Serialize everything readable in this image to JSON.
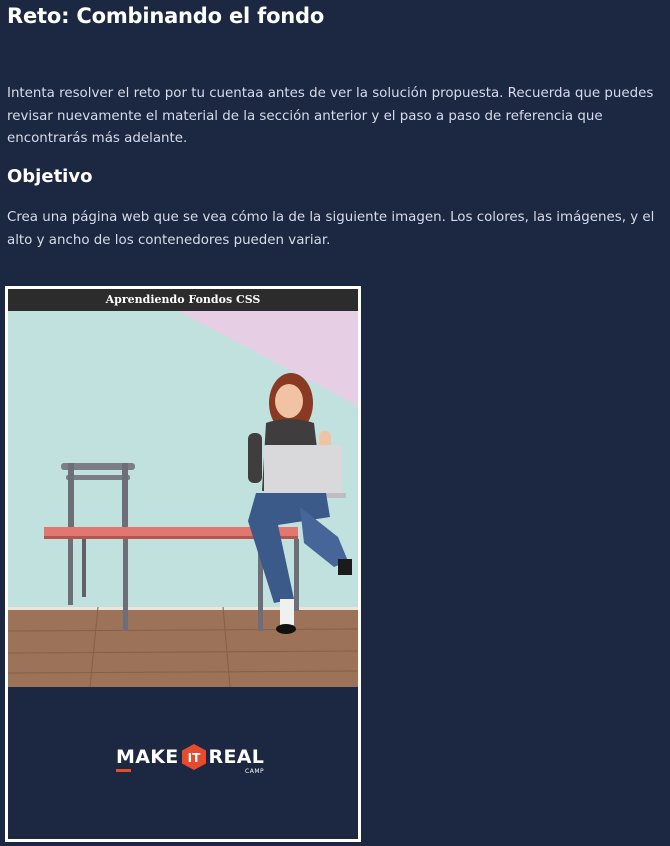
{
  "page": {
    "title": "Reto: Combinando el fondo",
    "intro": "Intenta resolver el reto por tu cuentaa antes de ver la solución propuesta. Recuerda que puedes revisar nuevamente el material de la sección anterior y el paso a paso de referencia que encontrarás más adelante.",
    "objective_heading": "Objetivo",
    "objective_text": "Crea una página web que se vea cómo la de la siguiente imagen. Los colores, las imágenes, y el alto y ancho de los contenedores pueden variar."
  },
  "preview": {
    "header_text": "Aprendiendo Fondos CSS",
    "logo": {
      "word_first": "MAKE",
      "word_mid": "IT",
      "word_last": "REAL",
      "sub": "CAMP",
      "accent_color": "#e64b2d"
    },
    "bottom_color": "#1c2742"
  },
  "colors": {
    "background": "#1c2742",
    "heading": "#ffffff",
    "text": "#d7dcea"
  }
}
